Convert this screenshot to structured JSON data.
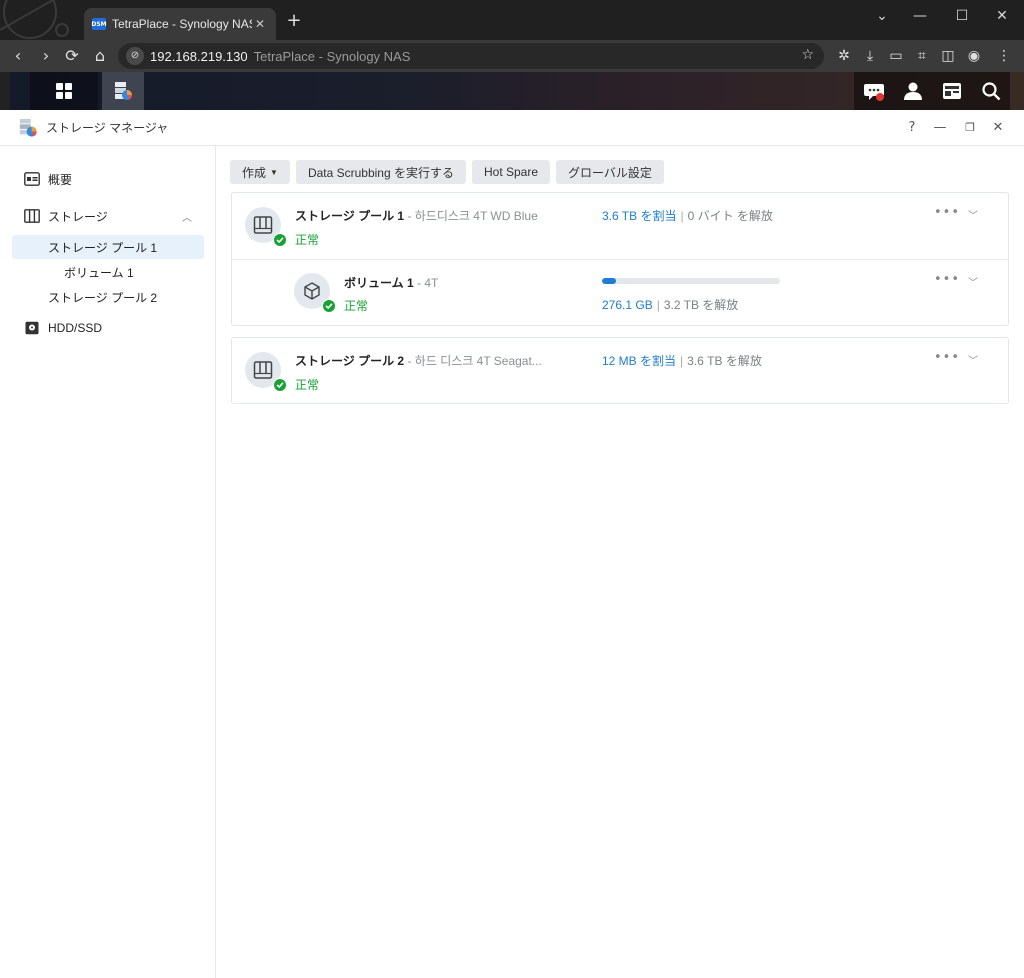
{
  "browser": {
    "tab_title": "TetraPlace - Synology NAS",
    "favicon_text": "DSM",
    "new_tab": "+",
    "url_host": "192.168.219.130",
    "url_title": "TetraPlace - Synology NAS"
  },
  "app": {
    "title": "ストレージ マネージャ",
    "help": "?"
  },
  "sidebar": {
    "items": [
      {
        "label": "概要",
        "icon": "overview-icon"
      },
      {
        "label": "ストレージ",
        "icon": "storage-icon"
      },
      {
        "label": "ストレージ プール 1"
      },
      {
        "label": "ボリューム 1"
      },
      {
        "label": "ストレージ プール 2"
      },
      {
        "label": "HDD/SSD",
        "icon": "hdd-icon"
      }
    ]
  },
  "toolbar": {
    "create": "作成",
    "scrub": "Data Scrubbing を実行する",
    "hotspare": "Hot Spare",
    "global": "グローバル設定"
  },
  "pools": [
    {
      "name": "ストレージ プール 1",
      "desc": " - 하드디스크 4T WD Blue",
      "status": "正常",
      "allocated": "3.6 TB を割当",
      "free": "0 バイト を解放",
      "volume": {
        "name": "ボリューム 1",
        "desc": " - 4T",
        "status": "正常",
        "used": "276.1 GB",
        "free": "3.2 TB を解放",
        "usage_fraction": 0.08
      }
    },
    {
      "name": "ストレージ プール 2",
      "desc": " - 하드 디스크 4T Seagat...",
      "status": "正常",
      "allocated": "12 MB を割当",
      "free": "3.6 TB を解放"
    }
  ],
  "colors": {
    "accent": "#1c7ed6",
    "ok": "#17a334",
    "selected_bg": "#e6f1fc"
  }
}
